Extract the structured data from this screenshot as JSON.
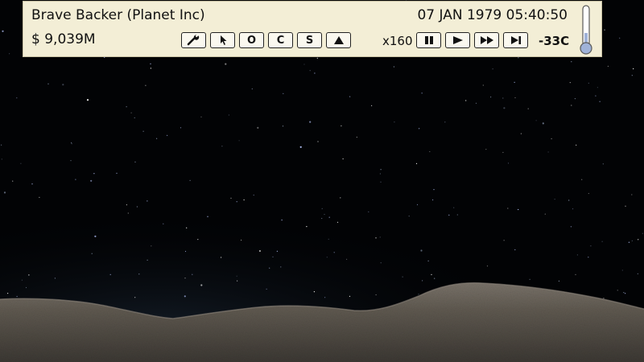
{
  "hud": {
    "company": "Brave Backer (Planet Inc)",
    "money": "$ 9,039M",
    "datetime": "07 JAN 1979 05:40:50",
    "speed": "x160",
    "temperature": "-33C"
  },
  "tools": [
    {
      "name": "wrench-tool-button",
      "icon": "wrench-icon"
    },
    {
      "name": "select-tool-button",
      "icon": "cursor-icon"
    },
    {
      "name": "o-tool-button",
      "label": "O"
    },
    {
      "name": "c-tool-button",
      "label": "C"
    },
    {
      "name": "s-tool-button",
      "label": "S"
    },
    {
      "name": "triangle-tool-button",
      "icon": "triangle-up-icon"
    }
  ],
  "speed_controls": [
    {
      "name": "pause-button",
      "icon": "pause-icon"
    },
    {
      "name": "play-button",
      "icon": "play-icon"
    },
    {
      "name": "fast-forward-button",
      "icon": "fast-forward-icon"
    },
    {
      "name": "skip-button",
      "icon": "skip-forward-icon"
    }
  ],
  "colors": {
    "hud_background": "#f3eed6",
    "sky": "#020305",
    "terrain": "#5e5850",
    "thermometer": "#9fb2d8"
  }
}
